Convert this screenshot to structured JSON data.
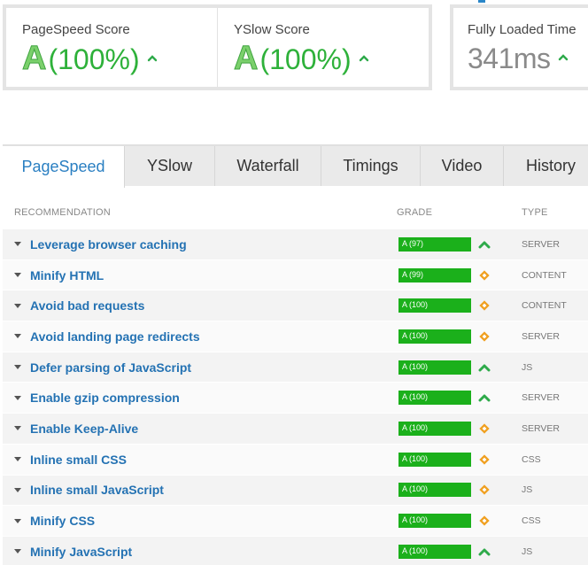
{
  "scores": {
    "pagespeed": {
      "label": "PageSpeed Score",
      "grade": "A",
      "percent": "(100%)"
    },
    "yslow": {
      "label": "YSlow Score",
      "grade": "A",
      "percent": "(100%)"
    },
    "fully_loaded": {
      "label": "Fully Loaded Time",
      "value": "341ms"
    }
  },
  "tabs": [
    {
      "label": "PageSpeed",
      "active": true
    },
    {
      "label": "YSlow"
    },
    {
      "label": "Waterfall"
    },
    {
      "label": "Timings"
    },
    {
      "label": "Video"
    },
    {
      "label": "History"
    }
  ],
  "table": {
    "headers": {
      "recommendation": "RECOMMENDATION",
      "grade": "GRADE",
      "type": "TYPE"
    },
    "rows": [
      {
        "name": "Leverage browser caching",
        "grade": "A (97)",
        "priority": "high",
        "type": "SERVER"
      },
      {
        "name": "Minify HTML",
        "grade": "A (99)",
        "priority": "medium",
        "type": "CONTENT"
      },
      {
        "name": "Avoid bad requests",
        "grade": "A (100)",
        "priority": "medium",
        "type": "CONTENT"
      },
      {
        "name": "Avoid landing page redirects",
        "grade": "A (100)",
        "priority": "medium",
        "type": "SERVER"
      },
      {
        "name": "Defer parsing of JavaScript",
        "grade": "A (100)",
        "priority": "high",
        "type": "JS"
      },
      {
        "name": "Enable gzip compression",
        "grade": "A (100)",
        "priority": "high",
        "type": "SERVER"
      },
      {
        "name": "Enable Keep-Alive",
        "grade": "A (100)",
        "priority": "medium",
        "type": "SERVER"
      },
      {
        "name": "Inline small CSS",
        "grade": "A (100)",
        "priority": "medium",
        "type": "CSS"
      },
      {
        "name": "Inline small JavaScript",
        "grade": "A (100)",
        "priority": "medium",
        "type": "JS"
      },
      {
        "name": "Minify CSS",
        "grade": "A (100)",
        "priority": "medium",
        "type": "CSS"
      },
      {
        "name": "Minify JavaScript",
        "grade": "A (100)",
        "priority": "high",
        "type": "JS"
      }
    ]
  },
  "colors": {
    "grade_green": "#1bb01b",
    "link_blue": "#2472b3",
    "priority_high": "#2eaa4a",
    "priority_medium": "#f0a020"
  }
}
